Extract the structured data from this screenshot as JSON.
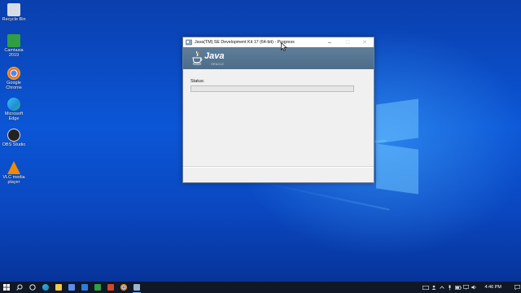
{
  "desktop": {
    "icons": [
      {
        "label": "Recycle Bin",
        "color": "#d8dde5",
        "icon": "recycle-bin-icon"
      },
      {
        "label": "Camtasia 2019",
        "color": "#2f9e44",
        "icon": "camtasia-icon"
      },
      {
        "label": "Google Chrome",
        "color": "#e8453c",
        "icon": "chrome-icon"
      },
      {
        "label": "Microsoft Edge",
        "color": "#1f8fd6",
        "icon": "edge-icon"
      },
      {
        "label": "OBS Studio",
        "color": "#222222",
        "icon": "obs-icon"
      },
      {
        "label": "VLC media player",
        "color": "#f08a00",
        "icon": "vlc-icon"
      }
    ]
  },
  "window": {
    "title": "Java(TM) SE Development Kit 17 (64-bit) - Progress",
    "banner_word": "Java",
    "banner_sub": "ORACLE",
    "status_label": "Status:",
    "progress": 0,
    "minimize": "–",
    "maximize": "□",
    "close": "✕"
  },
  "taskbar": {
    "clock": "4:46 PM",
    "apps": [
      {
        "icon": "start-icon",
        "color": "#ffffff"
      },
      {
        "icon": "search-icon",
        "color": "#ffffff"
      },
      {
        "icon": "task-view-icon",
        "color": "#ffffff"
      },
      {
        "icon": "edge-icon",
        "color": "#1f8fd6"
      },
      {
        "icon": "file-explorer-icon",
        "color": "#f2c94c"
      },
      {
        "icon": "store-icon",
        "color": "#5b8def"
      },
      {
        "icon": "mail-icon",
        "color": "#2a7de1"
      },
      {
        "icon": "camtasia-icon",
        "color": "#2f9e44"
      },
      {
        "icon": "powerpoint-icon",
        "color": "#d24726"
      },
      {
        "icon": "chrome-icon",
        "color": "#e8453c"
      },
      {
        "icon": "java-installer-icon",
        "color": "#9bb6cc"
      }
    ]
  }
}
